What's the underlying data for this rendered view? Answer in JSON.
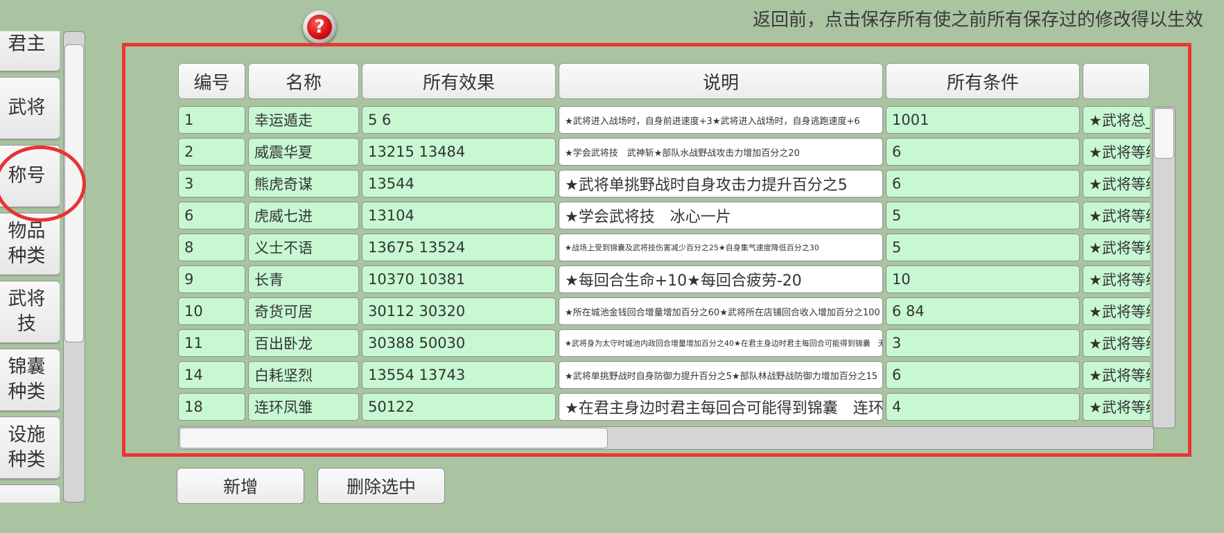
{
  "notice": "返回前，点击保存所有使之前所有保存过的修改得以生效",
  "help_icon": "?",
  "sidebar": {
    "items": [
      {
        "label": "君主"
      },
      {
        "label": "武将"
      },
      {
        "label": "称号",
        "highlighted": true
      },
      {
        "label": "物品种类"
      },
      {
        "label": "武将技"
      },
      {
        "label": "锦囊种类"
      },
      {
        "label": "设施种类"
      }
    ]
  },
  "table": {
    "columns": [
      "编号",
      "名称",
      "所有效果",
      "说明",
      "所有条件",
      ""
    ],
    "rows": [
      {
        "id": "1",
        "name": "幸运遁走",
        "effects": "5 6",
        "desc": "★武将进入战场时，自身前进速度+3★武将进入战场时，自身逃跑速度+6",
        "conds": "1001",
        "extra": "★武将总_"
      },
      {
        "id": "2",
        "name": "威震华夏",
        "effects": "13215 13484",
        "desc": "★学会武将技　武神斩★部队水战野战攻击力增加百分之20",
        "conds": "6",
        "extra": "★武将等级"
      },
      {
        "id": "3",
        "name": "熊虎奇谋",
        "effects": "13544",
        "desc": "★武将单挑野战时自身攻击力提升百分之5",
        "conds": "6",
        "extra": "★武将等级"
      },
      {
        "id": "6",
        "name": "虎威七进",
        "effects": "13104",
        "desc": "★学会武将技　冰心一片",
        "conds": "5",
        "extra": "★武将等级"
      },
      {
        "id": "8",
        "name": "义士不语",
        "effects": "13675 13524",
        "desc": "★战场上受到锦囊及武将技伤害减少百分之25★自身集气速度降低百分之30",
        "conds": "5",
        "extra": "★武将等级"
      },
      {
        "id": "9",
        "name": "长青",
        "effects": "10370 10381",
        "desc": "★每回合生命+10★每回合疲劳-20",
        "conds": "10",
        "extra": "★武将等级"
      },
      {
        "id": "10",
        "name": "奇货可居",
        "effects": "30112 30320",
        "desc": "★所在城池金钱回合增量增加百分之60★武将所在店铺回合收入增加百分之100",
        "conds": "6 84",
        "extra": "★武将等级"
      },
      {
        "id": "11",
        "name": "百出卧龙",
        "effects": "30388 50030",
        "desc": "★武将身为太守时城池内政回合增量增加百分之40★在君主身边时君主每回合可能得到锦囊　无中生有",
        "conds": "3",
        "extra": "★武将等级"
      },
      {
        "id": "14",
        "name": "白耗坚烈",
        "effects": "13554 13743",
        "desc": "★武将单挑野战时自身防御力提升百分之5★部队林战野战防御力增加百分之15",
        "conds": "6",
        "extra": "★武将等级"
      },
      {
        "id": "18",
        "name": "连环凤雏",
        "effects": "50122",
        "desc": "★在君主身边时君主每回合可能得到锦囊　连环计",
        "conds": "4",
        "extra": "★武将等级"
      }
    ]
  },
  "buttons": {
    "add": "新增",
    "delete_selected": "删除选中"
  },
  "colors": {
    "background": "#aac4a2",
    "cell_green": "#c7f8d2",
    "highlight_red": "#ee3333"
  }
}
